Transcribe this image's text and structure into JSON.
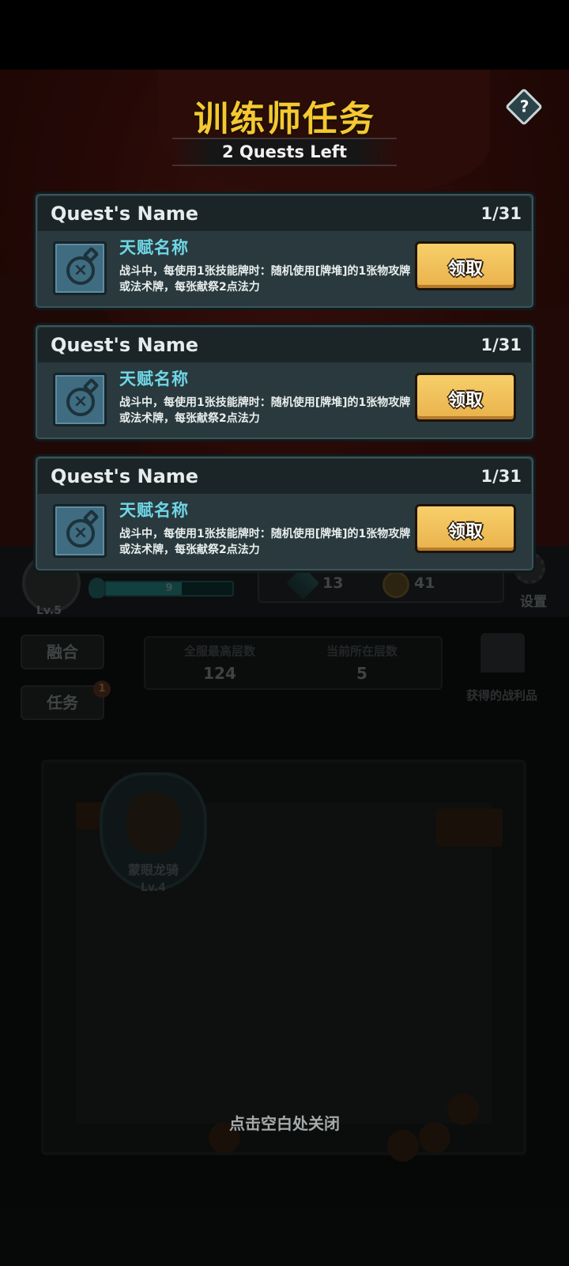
{
  "dialog": {
    "title": "训练师任务",
    "subtitle": "2 Quests Left",
    "help_label": "?",
    "quests": [
      {
        "name": "Quest's Name",
        "progress": "1/31",
        "talent_name": "天赋名称",
        "description": "战斗中，每使用1张技能牌时：随机使用[牌堆]的1张物攻牌或法术牌，每张献祭2点法力",
        "claim_label": "领取",
        "icon": "potion-bottle-icon"
      },
      {
        "name": "Quest's Name",
        "progress": "1/31",
        "talent_name": "天赋名称",
        "description": "战斗中，每使用1张技能牌时：随机使用[牌堆]的1张物攻牌或法术牌，每张献祭2点法力",
        "claim_label": "领取",
        "icon": "potion-bottle-icon"
      },
      {
        "name": "Quest's Name",
        "progress": "1/31",
        "talent_name": "天赋名称",
        "description": "战斗中，每使用1张技能牌时：随机使用[牌堆]的1张物攻牌或法术牌，每张献祭2点法力",
        "claim_label": "领取",
        "icon": "potion-bottle-icon"
      }
    ],
    "close_hint": "点击空白处关闭"
  },
  "background": {
    "player_level": "Lv.5",
    "mana_value": "9",
    "attack_value": "13",
    "gold_value": "41",
    "settings_label": "设置",
    "fuse_label": "融合",
    "task_label": "任务",
    "task_badge": "1",
    "max_floor_label": "全服最高层数",
    "max_floor_value": "124",
    "current_floor_label": "当前所在层数",
    "current_floor_value": "5",
    "loot_label": "获得的战利品",
    "unit_name": "蒙眼龙骑",
    "unit_level": "Lv.4"
  },
  "colors": {
    "title": "#f6c832",
    "talent_name": "#6fd6e6",
    "claim_button": "#f0c05a",
    "card_body": "#29393d",
    "card_header": "#1b2426"
  }
}
